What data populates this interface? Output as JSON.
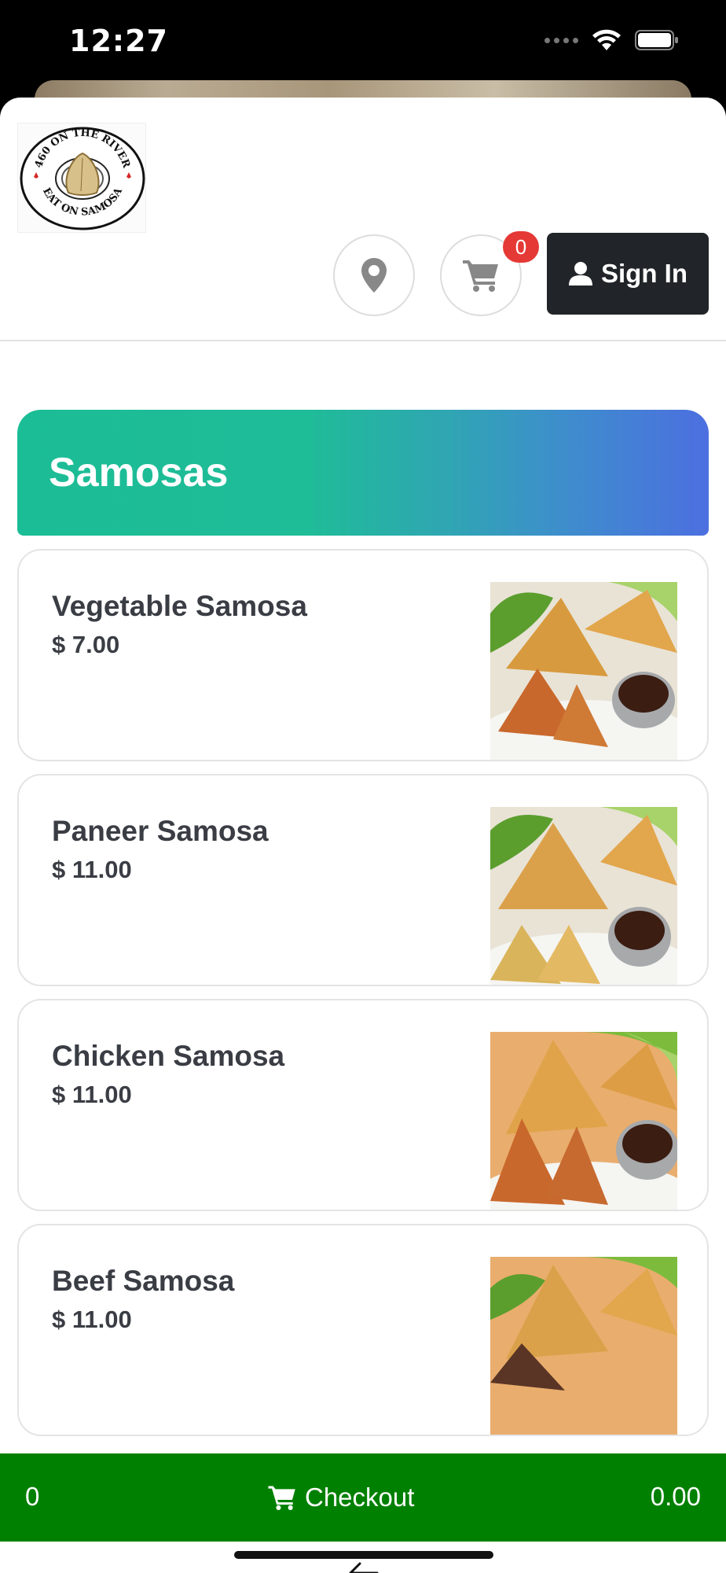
{
  "status_bar": {
    "time": "12:27"
  },
  "header": {
    "logo_text_top": "460 ON THE RIVER",
    "logo_text_bottom": "EAT ON SAMOSA",
    "location_icon": "map-marker-icon",
    "cart_icon": "shopping-cart-icon",
    "cart_count": "0",
    "signin_label": "Sign In",
    "signin_icon": "user-icon"
  },
  "category": {
    "title": "Samosas"
  },
  "items": [
    {
      "name": "Vegetable Samosa",
      "price": "$ 7.00"
    },
    {
      "name": "Paneer Samosa",
      "price": "$ 11.00"
    },
    {
      "name": "Chicken Samosa",
      "price": "$ 11.00"
    },
    {
      "name": "Beef Samosa",
      "price": "$ 11.00"
    }
  ],
  "checkout": {
    "count": "0",
    "label": "Checkout",
    "total": "0.00",
    "icon": "shopping-cart-icon"
  },
  "colors": {
    "checkout_green": "#008000",
    "banner_start": "#1bbd96",
    "banner_end": "#4c6fe0",
    "badge_red": "#e53935",
    "signin_dark": "#212529"
  }
}
